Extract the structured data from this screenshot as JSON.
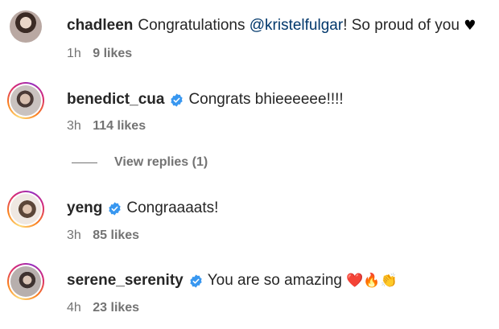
{
  "comments": [
    {
      "username": "chadleen",
      "verified": false,
      "text_before": "Congratulations ",
      "mention": "@kristelfulgar",
      "text_after": "! So proud of you",
      "trailing_emoji": "♥",
      "time": "1h",
      "likes": "9 likes"
    },
    {
      "username": "benedict_cua",
      "verified": true,
      "text": "Congrats bhieeeeee!!!!",
      "time": "3h",
      "likes": "114 likes",
      "view_replies": "View replies (1)"
    },
    {
      "username": "yeng",
      "verified": true,
      "text": "Congraaaats!",
      "time": "3h",
      "likes": "85 likes"
    },
    {
      "username": "serene_serenity",
      "verified": true,
      "text": "You are so amazing",
      "emojis": "❤️🔥👏",
      "time": "4h",
      "likes": "23 likes"
    }
  ],
  "colors": {
    "verified_badge": "#3897f0",
    "mention": "#00376b",
    "meta": "#737373"
  }
}
